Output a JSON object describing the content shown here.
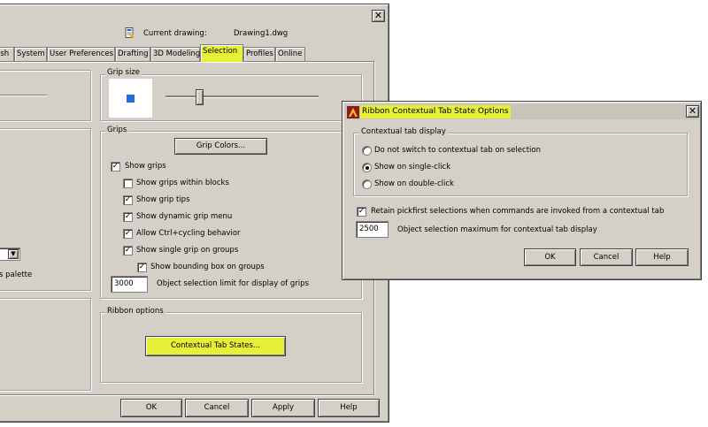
{
  "options_dialog": {
    "current_drawing_label": "Current drawing:",
    "current_drawing_value": "Drawing1.dwg",
    "close_glyph": "✕",
    "tabs": [
      {
        "label": "ish"
      },
      {
        "label": "System"
      },
      {
        "label": "User Preferences"
      },
      {
        "label": "Drafting"
      },
      {
        "label": "3D Modeling"
      },
      {
        "label": "Selection",
        "active": true
      },
      {
        "label": "Profiles"
      },
      {
        "label": "Online"
      }
    ],
    "grip_size": {
      "label": "Grip size"
    },
    "grips": {
      "label": "Grips",
      "grip_colors_button": "Grip Colors...",
      "checkboxes": [
        {
          "label": "Show grips",
          "checked": true
        },
        {
          "label": "Show grips within blocks",
          "checked": false
        },
        {
          "label": "Show grip tips",
          "checked": true
        },
        {
          "label": "Show dynamic grip menu",
          "checked": true
        },
        {
          "label": "Allow Ctrl+cycling behavior",
          "checked": true
        },
        {
          "label": "Show single grip on groups",
          "checked": true
        },
        {
          "label": "Show bounding box on groups",
          "checked": true
        }
      ],
      "limit_value": "3000",
      "limit_label": "Object selection limit for display of grips"
    },
    "ribbon_options": {
      "label": "Ribbon options",
      "contextual_button": "Contextual Tab States..."
    },
    "left_fragment": {
      "palette_text": "s palette"
    },
    "buttons": {
      "ok": "OK",
      "cancel": "Cancel",
      "apply": "Apply",
      "help": "Help"
    }
  },
  "ribbon_dialog": {
    "title": "Ribbon Contextual Tab State Options",
    "close_glyph": "✕",
    "group_label": "Contextual tab display",
    "radios": [
      {
        "label": "Do not switch to contextual tab on selection",
        "selected": false
      },
      {
        "label": "Show on single-click",
        "selected": true
      },
      {
        "label": "Show on double-click",
        "selected": false
      }
    ],
    "retain_label": "Retain pickfirst selections when commands are invoked from a contextual tab",
    "retain_checked": true,
    "max_value": "2500",
    "max_label": "Object selection maximum for contextual tab display",
    "buttons": {
      "ok": "OK",
      "cancel": "Cancel",
      "help": "Help"
    }
  },
  "colors": {
    "highlight": "#e8ef38",
    "dialog_bg": "#d4d0c8",
    "grip_blue": "#1f6fd6"
  },
  "glyphs": {
    "check": "✓",
    "dropdown": "▼"
  }
}
